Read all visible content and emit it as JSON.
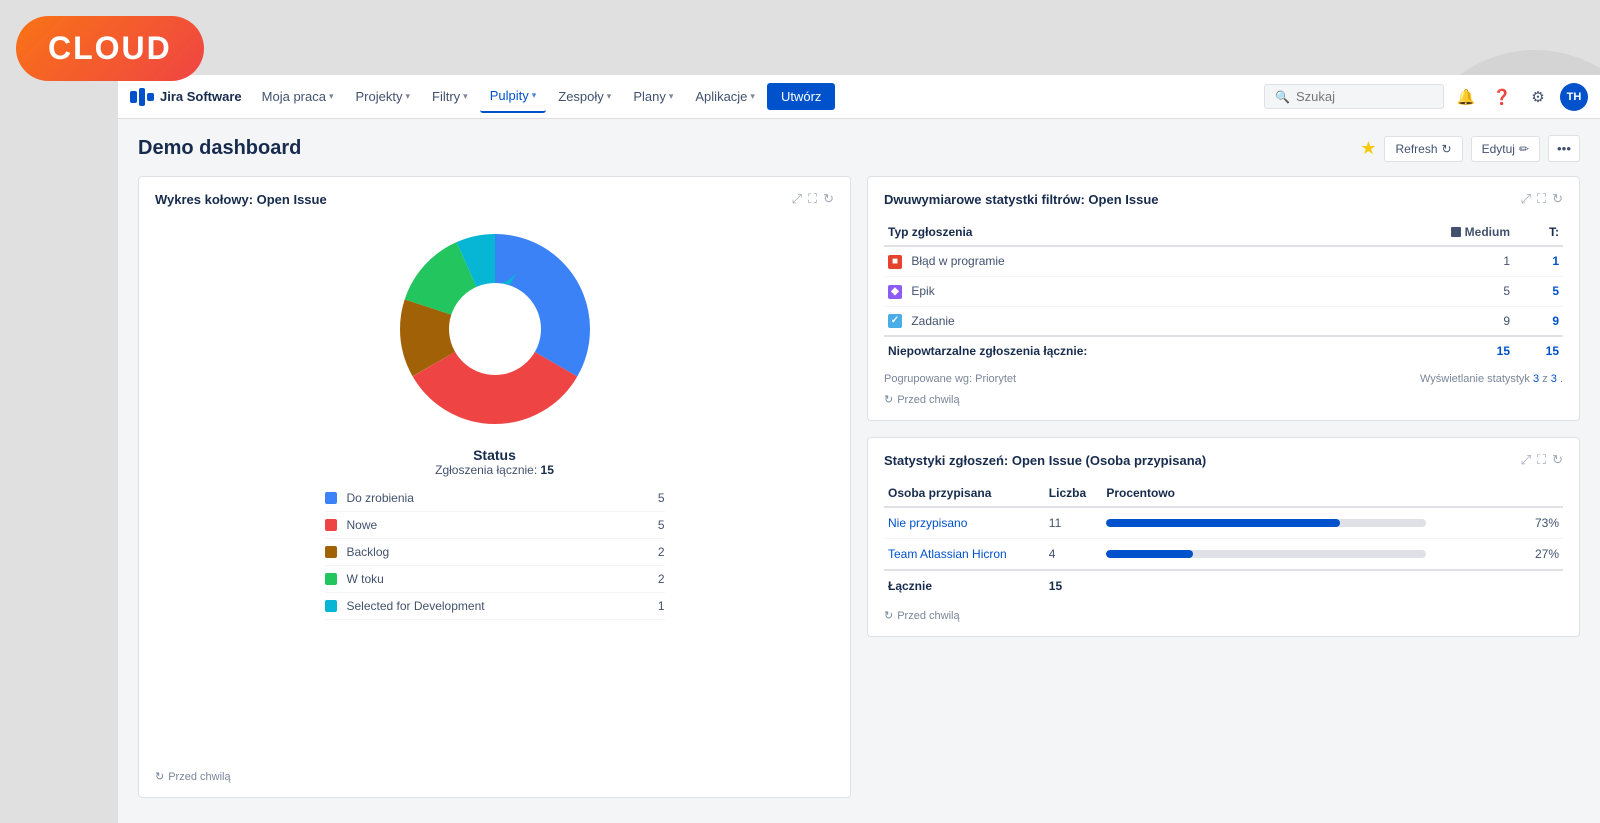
{
  "cloud_badge": {
    "label": "CLOUD"
  },
  "topnav": {
    "logo_name": "Jira Software",
    "nav_items": [
      {
        "label": "Moja praca",
        "has_chevron": true
      },
      {
        "label": "Projekty",
        "has_chevron": true
      },
      {
        "label": "Filtry",
        "has_chevron": true
      },
      {
        "label": "Pulpity",
        "has_chevron": true,
        "active": true
      },
      {
        "label": "Zespoły",
        "has_chevron": true
      },
      {
        "label": "Plany",
        "has_chevron": true
      },
      {
        "label": "Aplikacje",
        "has_chevron": true
      }
    ],
    "create_label": "Utwórz",
    "search_placeholder": "Szukaj",
    "avatar": "TH"
  },
  "dashboard": {
    "title": "Demo dashboard",
    "refresh_label": "Refresh",
    "edit_label": "Edytuj",
    "widgets": {
      "pie": {
        "title": "Wykres kołowy: Open Issue",
        "status_label": "Status",
        "total_label": "Zgłoszenia łącznie:",
        "total_count": "15",
        "footer_text": "Przed chwilą",
        "legend": [
          {
            "color": "#3b82f6",
            "label": "Do zrobienia",
            "value": 5
          },
          {
            "color": "#ef4444",
            "label": "Nowe",
            "value": 5
          },
          {
            "color": "#a16207",
            "label": "Backlog",
            "value": 2
          },
          {
            "color": "#22c55e",
            "label": "W toku",
            "value": 2
          },
          {
            "color": "#06b6d4",
            "label": "Selected for Development",
            "value": 1
          }
        ],
        "donut_segments": [
          {
            "color": "#3b82f6",
            "value": 5
          },
          {
            "color": "#ef4444",
            "value": 5
          },
          {
            "color": "#a16207",
            "value": 2
          },
          {
            "color": "#22c55e",
            "value": 2
          },
          {
            "color": "#06b6d4",
            "value": 1
          }
        ]
      },
      "filter_stats": {
        "title": "Dwuwymiarowe statystki filtrów: Open Issue",
        "col_header_type": "Typ zgłoszenia",
        "col_header_medium": "Medium",
        "col_header_total": "T:",
        "rows": [
          {
            "icon_class": "icon-bug",
            "icon_char": "■",
            "label": "Błąd w programie",
            "medium": 1,
            "total": 1
          },
          {
            "icon_class": "icon-epic",
            "icon_char": "◆",
            "label": "Epik",
            "medium": 5,
            "total": 5
          },
          {
            "icon_class": "icon-task",
            "icon_char": "✓",
            "label": "Zadanie",
            "medium": 9,
            "total": 9
          }
        ],
        "total_row": {
          "label": "Niepowtarzalne zgłoszenia łącznie:",
          "medium": 15,
          "total": 15
        },
        "group_by": "Pogrupowane wg: Priorytet",
        "showing": "Wyświetlanie statystyk",
        "showing_count": "3",
        "showing_total": "3",
        "footer_text": "Przed chwilą"
      },
      "assignee_stats": {
        "title": "Statystyki zgłoszeń: Open Issue (Osoba przypisana)",
        "col_person": "Osoba przypisana",
        "col_count": "Liczba",
        "col_percent": "Procentowo",
        "rows": [
          {
            "name": "Nie przypisano",
            "count": 11,
            "percent": 73,
            "percent_label": "73%"
          },
          {
            "name": "Team Atlassian Hicron",
            "count": 4,
            "percent": 27,
            "percent_label": "27%"
          }
        ],
        "total_row": {
          "label": "Łącznie",
          "count": 15
        },
        "footer_text": "Przed chwilą"
      }
    }
  }
}
